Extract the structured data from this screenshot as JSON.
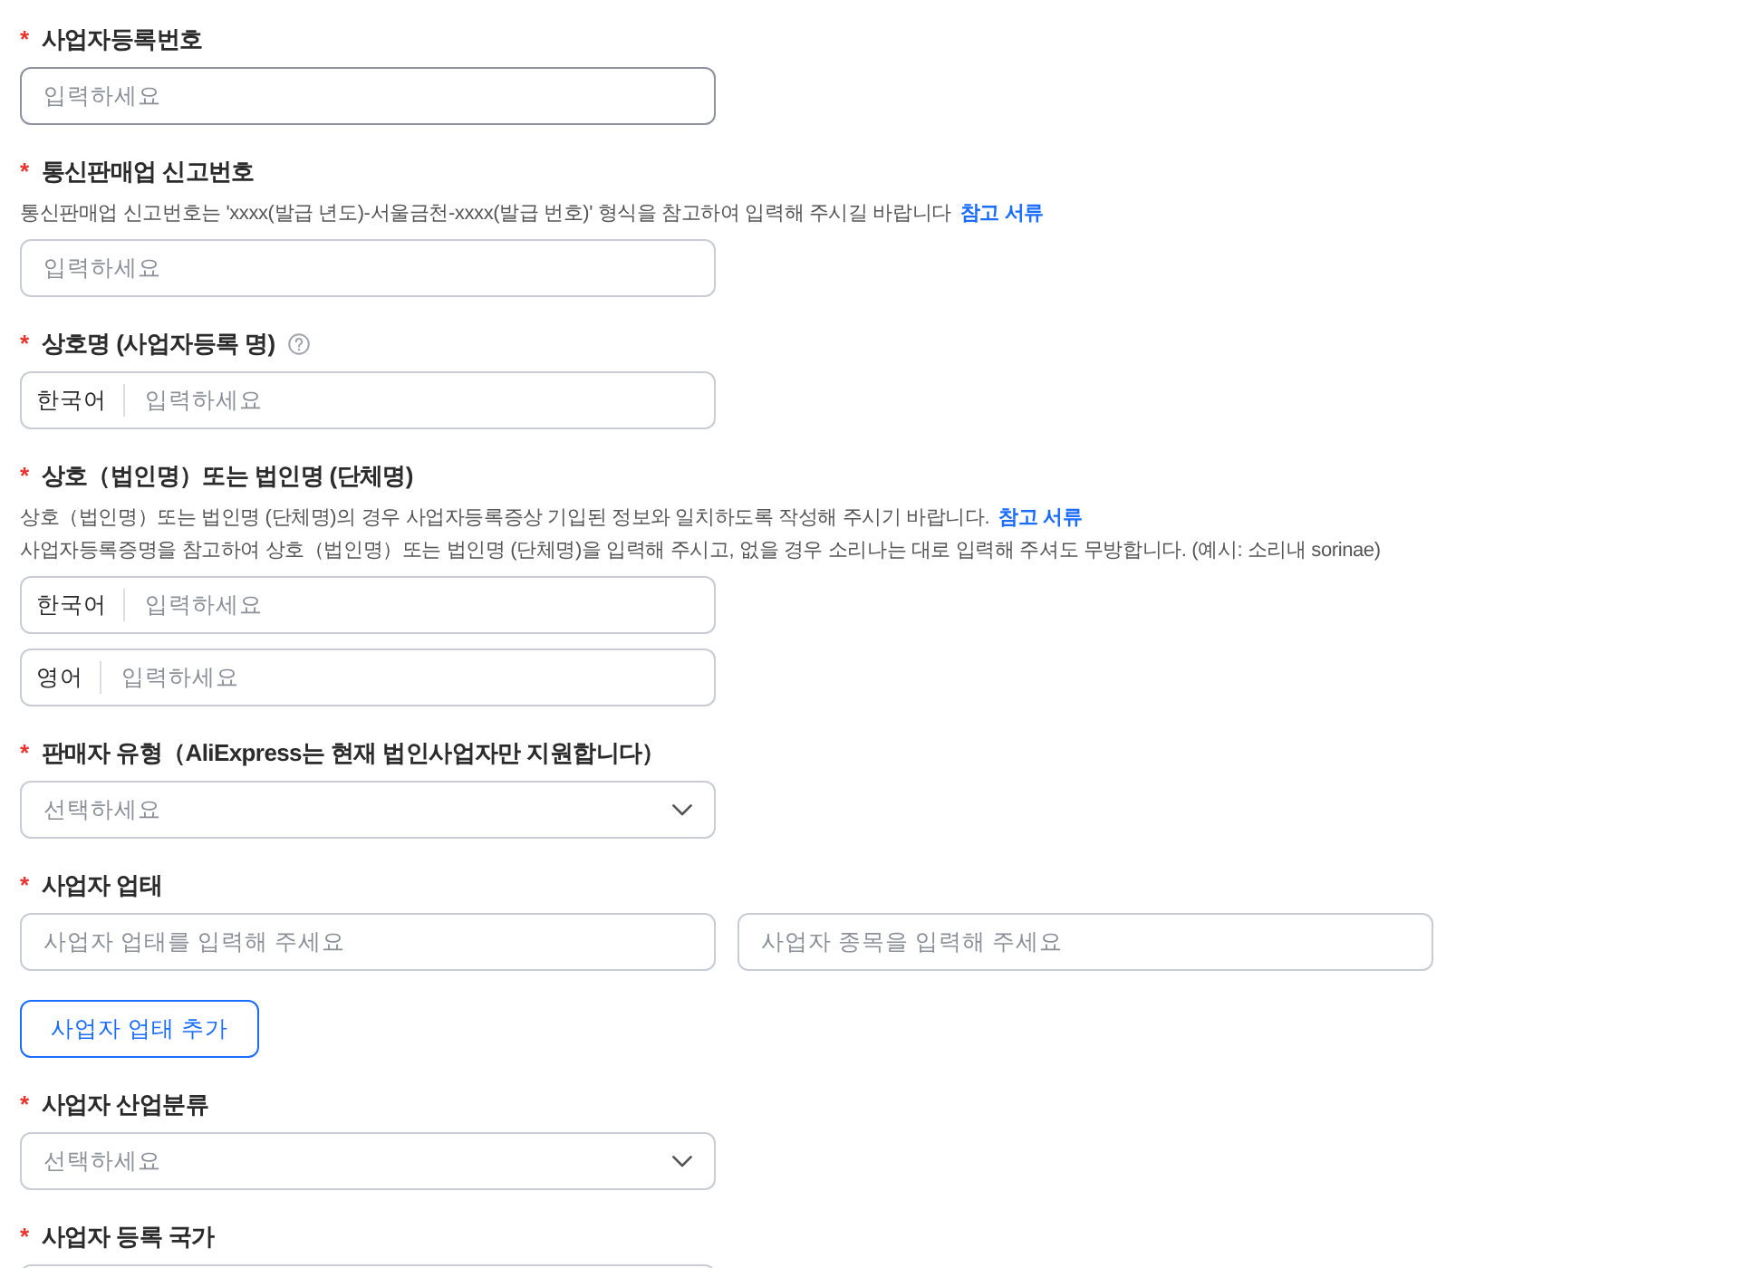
{
  "sections": [
    {
      "required_mark": "*",
      "label": "사업자등록번호",
      "rows": [
        [
          {
            "kind": "input",
            "placeholder": "입력하세요",
            "highlighted": true
          }
        ]
      ]
    },
    {
      "required_mark": "*",
      "label": "통신판매업 신고번호",
      "notes": [
        {
          "text": "통신판매업 신고번호는 'xxxx(발급 년도)-서울금천-xxxx(발급 번호)' 형식을 참고하여 입력해 주시길 바랍니다",
          "link": "참고 서류"
        }
      ],
      "rows": [
        [
          {
            "kind": "input",
            "placeholder": "입력하세요",
            "highlighted": false
          }
        ]
      ]
    },
    {
      "required_mark": "*",
      "label": "상호명 (사업자등록 명)",
      "info_icon": true,
      "rows": [
        [
          {
            "kind": "language_input",
            "language": "한국어",
            "placeholder": "입력하세요",
            "highlighted": false
          }
        ]
      ]
    },
    {
      "required_mark": "*",
      "label": "상호（법인명）또는 법인명 (단체명)",
      "notes": [
        {
          "text": "상호（법인명）또는 법인명 (단체명)의 경우 사업자등록증상 기입된 정보와 일치하도록 작성해 주시기 바랍니다.",
          "link": "참고 서류"
        },
        {
          "text": "사업자등록증명을 참고하여 상호（법인명）또는 법인명 (단체명)을 입력해 주시고, 없을 경우 소리나는 대로 입력해 주셔도 무방합니다. (예시: 소리내 sorinae)"
        }
      ],
      "rows": [
        [
          {
            "kind": "language_input",
            "language": "한국어",
            "placeholder": "입력하세요",
            "highlighted": false
          }
        ],
        [
          {
            "kind": "language_input",
            "language": "영어",
            "placeholder": "입력하세요",
            "highlighted": false
          }
        ]
      ]
    },
    {
      "required_mark": "*",
      "label": "판매자 유형（AliExpress는 현재 법인사업자만 지원합니다）",
      "rows": [
        [
          {
            "kind": "select",
            "placeholder": "선택하세요",
            "highlighted": false
          }
        ]
      ]
    },
    {
      "required_mark": "*",
      "label": "사업자 업태",
      "rows": [
        [
          {
            "kind": "input",
            "placeholder": "사업자 업태를 입력해 주세요",
            "highlighted": false
          },
          {
            "kind": "input",
            "placeholder": "사업자 종목을 입력해 주세요",
            "highlighted": false
          }
        ]
      ],
      "button": "사업자 업태 추가"
    },
    {
      "required_mark": "*",
      "label": "사업자 산업분류",
      "rows": [
        [
          {
            "kind": "select",
            "placeholder": "선택하세요",
            "highlighted": false
          }
        ]
      ]
    },
    {
      "required_mark": "*",
      "label": "사업자 등록 국가",
      "rows": [
        [
          {
            "kind": "input",
            "highlighted": false
          }
        ]
      ]
    }
  ]
}
